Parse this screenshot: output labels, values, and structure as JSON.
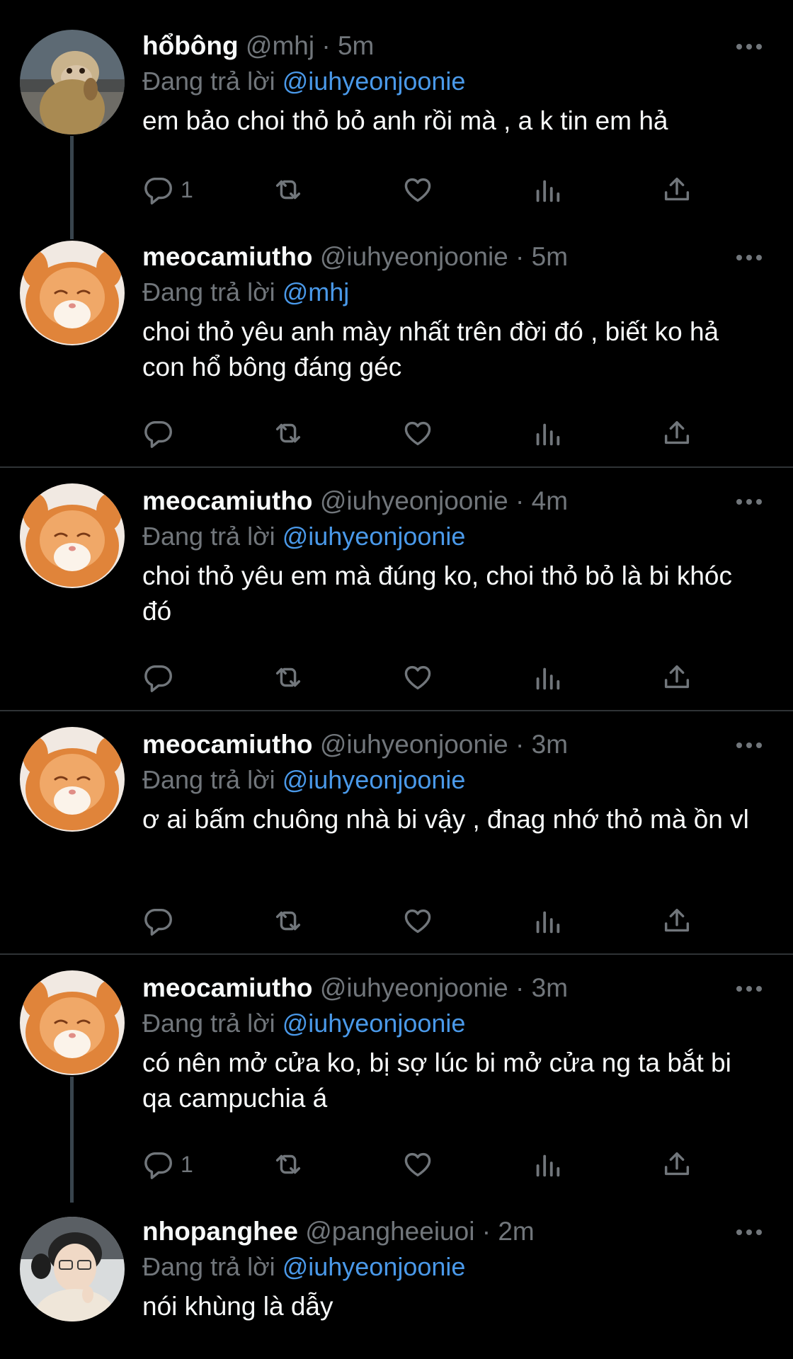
{
  "tweets": [
    {
      "name": "hổbông",
      "handle": "@mhj",
      "time": "5m",
      "reply_prefix": "Đang trả lời",
      "reply_to": "@iuhyeonjoonie",
      "text": "em bảo choi thỏ bỏ anh rồi mà , a k tin em hả",
      "reply_count": "1",
      "avatar": "monkey-avatar"
    },
    {
      "name": "meocamiutho",
      "handle": "@iuhyeonjoonie",
      "time": "5m",
      "reply_prefix": "Đang trả lời",
      "reply_to": "@mhj",
      "text": "choi thỏ yêu anh mày nhất trên đời đó , biết ko hả con hổ bông đáng géc",
      "reply_count": "",
      "avatar": "orange-cat-avatar"
    },
    {
      "name": "meocamiutho",
      "handle": "@iuhyeonjoonie",
      "time": "4m",
      "reply_prefix": "Đang trả lời",
      "reply_to": "@iuhyeonjoonie",
      "text": "choi thỏ yêu em mà đúng ko, choi thỏ bỏ là bi khóc đó",
      "reply_count": "",
      "avatar": "orange-cat-avatar"
    },
    {
      "name": "meocamiutho",
      "handle": "@iuhyeonjoonie",
      "time": "3m",
      "reply_prefix": "Đang trả lời",
      "reply_to": "@iuhyeonjoonie",
      "text": "ơ ai bấm chuông nhà bi vậy , đnag nhớ thỏ mà ồn vl",
      "reply_count": "",
      "avatar": "orange-cat-avatar"
    },
    {
      "name": "meocamiutho",
      "handle": "@iuhyeonjoonie",
      "time": "3m",
      "reply_prefix": "Đang trả lời",
      "reply_to": "@iuhyeonjoonie",
      "text": "có nên mở cửa ko, bị sợ lúc bi mở cửa ng ta bắt bi qa campuchia á",
      "reply_count": "1",
      "avatar": "orange-cat-avatar"
    },
    {
      "name": "nhopanghee",
      "handle": "@pangheeiuoi",
      "time": "2m",
      "reply_prefix": "Đang trả lời",
      "reply_to": "@iuhyeonjoonie",
      "text": "nói khùng là dẫy",
      "reply_count": "",
      "avatar": "person-avatar"
    }
  ],
  "separator": "·",
  "colors": {
    "background": "#000000",
    "text": "#f7f9f9",
    "muted": "#71767b",
    "mention": "#4a99e9",
    "divider": "#2f3336",
    "thread_line": "#38444d"
  },
  "icons": [
    "more-icon",
    "reply-icon",
    "retweet-icon",
    "like-icon",
    "views-icon",
    "share-icon"
  ]
}
